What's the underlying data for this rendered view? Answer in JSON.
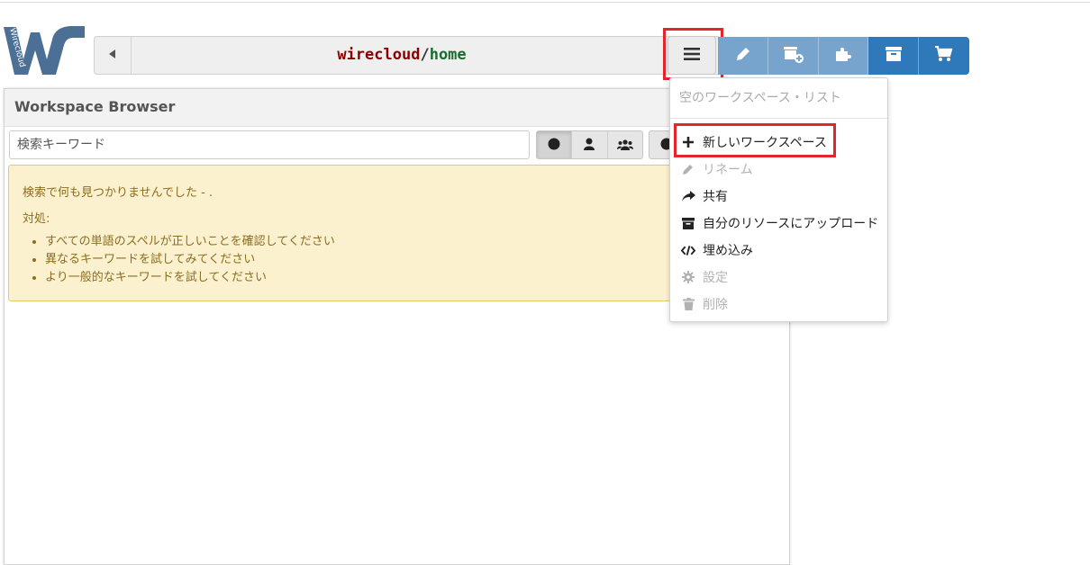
{
  "logo": {
    "text": "Wirecloud",
    "letters": "WC",
    "color": "#4b6f95"
  },
  "pathbar": {
    "owner": "wirecloud",
    "separator": "/",
    "name": "home"
  },
  "menu_button": {
    "icon": "hamburger-icon"
  },
  "toolbar": {
    "buttons": [
      {
        "icon": "pencil-icon",
        "style": "light"
      },
      {
        "icon": "add-workspace-icon",
        "style": "light"
      },
      {
        "icon": "puzzle-icon",
        "style": "light"
      },
      {
        "icon": "archive-icon",
        "style": "dark"
      },
      {
        "icon": "cart-icon",
        "style": "dark"
      }
    ]
  },
  "workspace_browser": {
    "title": "Workspace Browser",
    "search_placeholder": "検索キーワード",
    "filters": [
      "circle-icon",
      "user-icon",
      "group-icon"
    ],
    "alert": {
      "title": "検索で何も見つかりませんでした - .",
      "subtitle": "対処:",
      "items": [
        "すべての単語のスペルが正しいことを確認してください",
        "異なるキーワードを試してみてください",
        "より一般的なキーワードを試してください"
      ]
    }
  },
  "dropdown": {
    "header": "空のワークスペース・リスト",
    "items": [
      {
        "label": "新しいワークスペース",
        "icon": "plus-icon",
        "disabled": false
      },
      {
        "label": "リネーム",
        "icon": "pencil-icon",
        "disabled": true
      },
      {
        "label": "共有",
        "icon": "share-icon",
        "disabled": false
      },
      {
        "label": "自分のリソースにアップロード",
        "icon": "archive-icon",
        "disabled": false
      },
      {
        "label": "埋め込み",
        "icon": "code-icon",
        "disabled": false
      },
      {
        "label": "設定",
        "icon": "gear-icon",
        "disabled": true
      },
      {
        "label": "削除",
        "icon": "trash-icon",
        "disabled": true
      }
    ]
  },
  "highlight_color": "#e2262c"
}
